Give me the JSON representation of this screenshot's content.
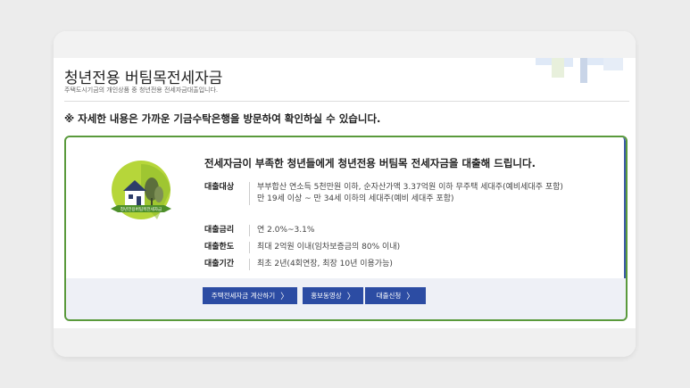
{
  "page": {
    "title": "청년전용 버팀목전세자금",
    "subtitle": "주택도시기금의 개인상품 중 청년전용 전세자금대출입니다.",
    "notice": "※ 자세한 내용은 가까운 기금수탁은행을 방문하여 확인하실 수 있습니다."
  },
  "product": {
    "logo_text": "청년전용버팀목전세자금",
    "headline": "전세자금이 부족한 청년들에게 청년전용 버팀목 전세자금을 대출해 드립니다.",
    "rows": [
      {
        "key": "대출대상",
        "value": "부부합산 연소득 5천만원 이하, 순자산가액 3.37억원 이하 무주택 세대주(예비세대주 포함)",
        "value2": "만 19세 이상 ~ 만 34세 이하의 세대주(예비 세대주 포함)"
      },
      {
        "key": "대출금리",
        "value": "연 2.0%~3.1%"
      },
      {
        "key": "대출한도",
        "value": "최대 2억원 이내(임차보증금의 80% 이내)"
      },
      {
        "key": "대출기간",
        "value": "최초 2년(4회연장, 최장 10년 이용가능)"
      }
    ]
  },
  "buttons": {
    "calc": "주택전세자금 계산하기",
    "video": "홍보동영상",
    "apply": "대출신청",
    "chevron": "〉"
  },
  "colors": {
    "box_border_green": "#5a9a3c",
    "box_border_blue": "#3c5aa8",
    "button_bg": "#2c4ca3",
    "logo_circle": "#b6d63a"
  }
}
